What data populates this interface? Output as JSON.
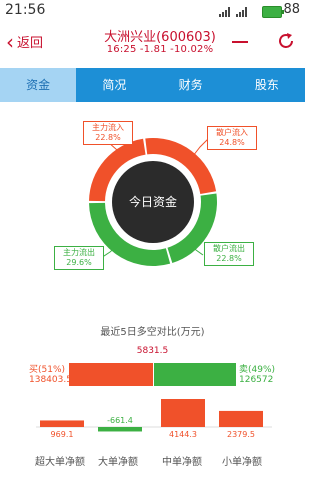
{
  "status": {
    "time": "21:56",
    "battery": "88"
  },
  "header": {
    "back_label": "返回",
    "stock_title": "大洲兴业(600603)",
    "quote": "16:25 -1.81 -10.02%"
  },
  "tabs": [
    {
      "label": "资金",
      "active": true
    },
    {
      "label": "简况",
      "active": false
    },
    {
      "label": "财务",
      "active": false
    },
    {
      "label": "股东",
      "active": false
    }
  ],
  "donut": {
    "center_label": "今日资金",
    "segments": [
      {
        "name": "主力流入",
        "percent": "22.8%",
        "value": 22.8,
        "color": "#f0512a"
      },
      {
        "name": "散户流入",
        "percent": "24.8%",
        "value": 24.8,
        "color": "#f0512a"
      },
      {
        "name": "散户流出",
        "percent": "22.8%",
        "value": 22.8,
        "color": "#3cb043"
      },
      {
        "name": "主力流出",
        "percent": "29.6%",
        "value": 29.6,
        "color": "#3cb043"
      }
    ]
  },
  "comparison": {
    "title": "最近5日多空对比(万元)",
    "diff_value": "5831.5",
    "buy_label": "买(51%)",
    "buy_value": "138403.5",
    "sell_label": "卖(49%)",
    "sell_value": "126572",
    "buy_percent": 51,
    "sell_percent": 49
  },
  "net_bars": {
    "items": [
      {
        "category": "超大单净额",
        "value": 969.1,
        "label": "969.1"
      },
      {
        "category": "大单净额",
        "value": -661.4,
        "label": "-661.4"
      },
      {
        "category": "中单净额",
        "value": 4144.3,
        "label": "4144.3"
      },
      {
        "category": "小单净额",
        "value": 2379.5,
        "label": "2379.5"
      }
    ]
  },
  "colors": {
    "accent_red": "#c8102e",
    "up": "#f0512a",
    "down": "#3cb043",
    "tab_blue": "#1d8fd6"
  }
}
